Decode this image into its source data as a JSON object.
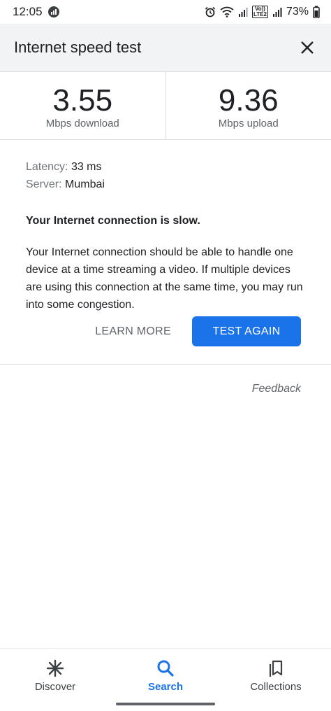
{
  "status_bar": {
    "time": "12:05",
    "battery": "73%",
    "network_label": "LTE2",
    "volte_label": "Vo))"
  },
  "header": {
    "title": "Internet speed test",
    "close_icon": "close-icon"
  },
  "results": {
    "download_value": "3.55",
    "download_unit": "Mbps download",
    "upload_value": "9.36",
    "upload_unit": "Mbps upload"
  },
  "details": {
    "latency_label": "Latency:",
    "latency_value": "33 ms",
    "server_label": "Server:",
    "server_value": "Mumbai",
    "status_message": "Your Internet connection is slow.",
    "description": "Your Internet connection should be able to handle one device at a time streaming a video. If multiple devices are using this connection at the same time, you may run into some congestion."
  },
  "actions": {
    "learn_more": "LEARN MORE",
    "test_again": "TEST AGAIN"
  },
  "feedback": "Feedback",
  "bottom_nav": {
    "items": [
      {
        "label": "Discover",
        "icon": "asterisk-icon"
      },
      {
        "label": "Search",
        "icon": "search-icon",
        "active": true
      },
      {
        "label": "Collections",
        "icon": "collections-icon"
      }
    ]
  },
  "colors": {
    "accent": "#1a73e8",
    "header_bg": "#f1f3f4"
  }
}
